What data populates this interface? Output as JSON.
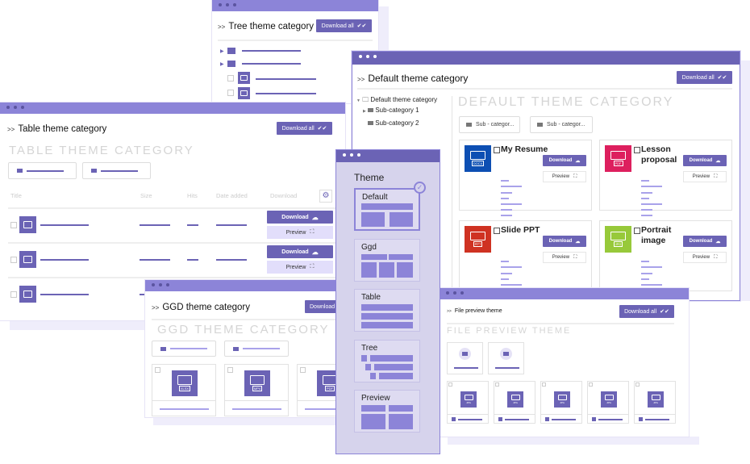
{
  "tree_window": {
    "title": "Tree theme category",
    "download_all": "Download all"
  },
  "table_window": {
    "title": "Table theme category",
    "download_all": "Download all",
    "heading": "TABLE THEME CATEGORY",
    "columns": [
      "Title",
      "Size",
      "Hits",
      "Date added",
      "Download"
    ],
    "rows": [
      {
        "icon": "ppt"
      },
      {
        "icon": "mp4"
      },
      {
        "icon": "jpg"
      }
    ],
    "download_label": "Download",
    "preview_label": "Preview"
  },
  "default_window": {
    "title": "Default theme category",
    "download_all": "Download all",
    "heading": "DEFAULT THEME CATEGORY",
    "tree": {
      "root": "Default theme category",
      "children": [
        "Sub-category 1",
        "Sub-category 2"
      ]
    },
    "folders": [
      "Sub - categor...",
      "Sub - categor..."
    ],
    "files": [
      {
        "title": "My Resume",
        "type": "DOCX",
        "color": "#0d4fb3"
      },
      {
        "title": "Lesson proposal",
        "type": "PDF",
        "color": "#dd1f5e"
      },
      {
        "title": "Slide PPT",
        "type": "PPT",
        "color": "#cf3222"
      },
      {
        "title": "Portrait image",
        "type": "JPG",
        "color": "#97c93a"
      }
    ],
    "download_label": "Download",
    "preview_label": "Preview"
  },
  "ggd_window": {
    "title": "GGD theme category",
    "download_all": "Download all",
    "heading": "GGD THEME CATEGORY",
    "files": [
      "XLSX",
      "MP4",
      "PDF"
    ]
  },
  "theme_panel": {
    "title": "Theme",
    "options": [
      "Default",
      "Ggd",
      "Table",
      "Tree",
      "Preview"
    ],
    "selected": "Default"
  },
  "file_preview_window": {
    "title": "File preview theme",
    "download_all": "Download all",
    "heading": "FILE PREVIEW THEME",
    "files": [
      "JPG",
      "JPG",
      "JPG",
      "JPG",
      "JPG"
    ]
  },
  "colors": {
    "accent": "#6b63b5",
    "bar": "#8c84d8",
    "panel": "#d6d3ec"
  }
}
